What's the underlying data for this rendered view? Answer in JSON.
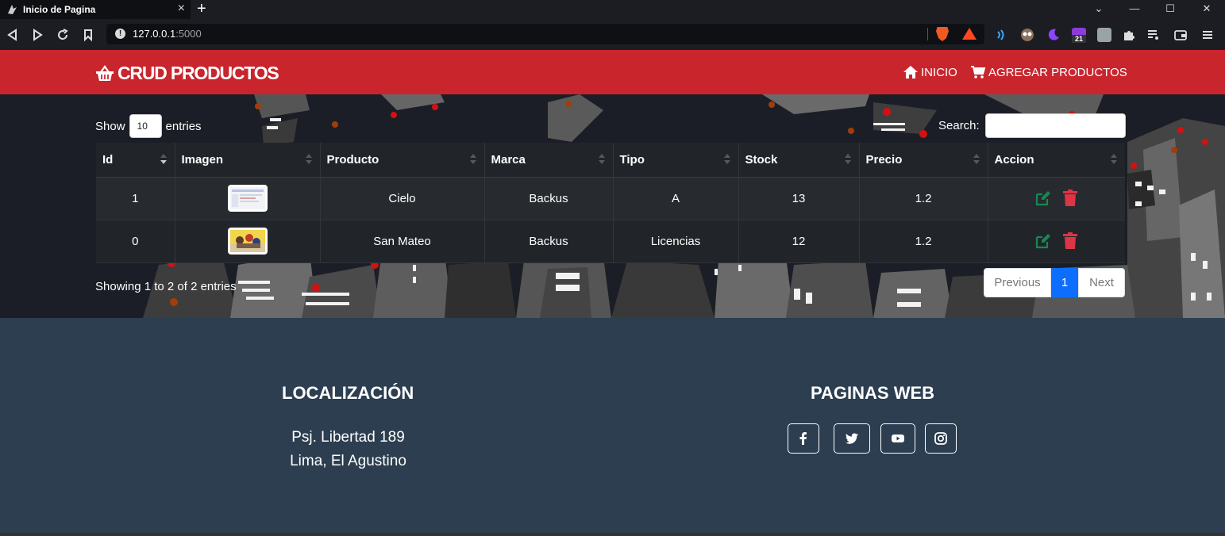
{
  "browser": {
    "tab_title": "Inicio de Pagina",
    "tab_close": "×",
    "new_tab": "+",
    "url_host": "127.0.0.1",
    "url_port": ":5000",
    "window_controls": [
      "⌄",
      "—",
      "☐",
      "✕"
    ],
    "ext_badge": "21"
  },
  "header": {
    "brand": "CRUD PRODUCTOS",
    "nav": [
      {
        "label": "INICIO",
        "icon": "home-icon"
      },
      {
        "label": "AGREGAR PRODUCTOS",
        "icon": "cart-icon"
      }
    ]
  },
  "table_controls": {
    "show_label": "Show",
    "page_length": "10",
    "entries_label": "entries",
    "search_label": "Search:"
  },
  "table": {
    "columns": [
      "Id",
      "Imagen",
      "Producto",
      "Marca",
      "Tipo",
      "Stock",
      "Precio",
      "Accion"
    ],
    "rows": [
      {
        "id": "1",
        "producto": "Cielo",
        "marca": "Backus",
        "tipo": "A",
        "stock": "13",
        "precio": "1.2"
      },
      {
        "id": "0",
        "producto": "San Mateo",
        "marca": "Backus",
        "tipo": "Licencias",
        "stock": "12",
        "precio": "1.2"
      }
    ]
  },
  "pagination": {
    "info": "Showing 1 to 2 of 2 entries",
    "previous": "Previous",
    "current": "1",
    "next": "Next"
  },
  "footer": {
    "location_title": "LOCALIZACIÓN",
    "address_line1": "Psj. Libertad 189",
    "address_line2": "Lima, El Agustino",
    "web_title": "PAGINAS WEB",
    "social": [
      "facebook-icon",
      "twitter-icon",
      "youtube-icon",
      "instagram-icon"
    ]
  },
  "colors": {
    "header_red": "#c9252d",
    "footer_bg": "#2c3e50",
    "edit_green": "#198754",
    "delete_red": "#dc3545",
    "page_active": "#0d6efd"
  }
}
